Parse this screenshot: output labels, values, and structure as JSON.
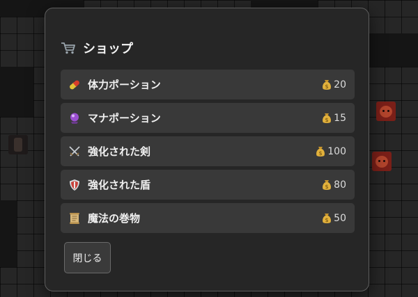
{
  "shop": {
    "title": "ショップ",
    "title_icon": "shopping-cart-icon",
    "items": [
      {
        "name": "体力ポーション",
        "icon": "pill-icon",
        "price": "20"
      },
      {
        "name": "マナポーション",
        "icon": "crystal-ball-icon",
        "price": "15"
      },
      {
        "name": "強化された剣",
        "icon": "crossed-swords-icon",
        "price": "100"
      },
      {
        "name": "強化された盾",
        "icon": "shield-icon",
        "price": "80"
      },
      {
        "name": "魔法の巻物",
        "icon": "scroll-icon",
        "price": "50"
      }
    ],
    "currency_icon": "money-bag-icon",
    "close_label": "閉じる"
  },
  "colors": {
    "panel": "#262626",
    "row": "#393939",
    "text": "#f0f0f0",
    "board": "#262626"
  }
}
